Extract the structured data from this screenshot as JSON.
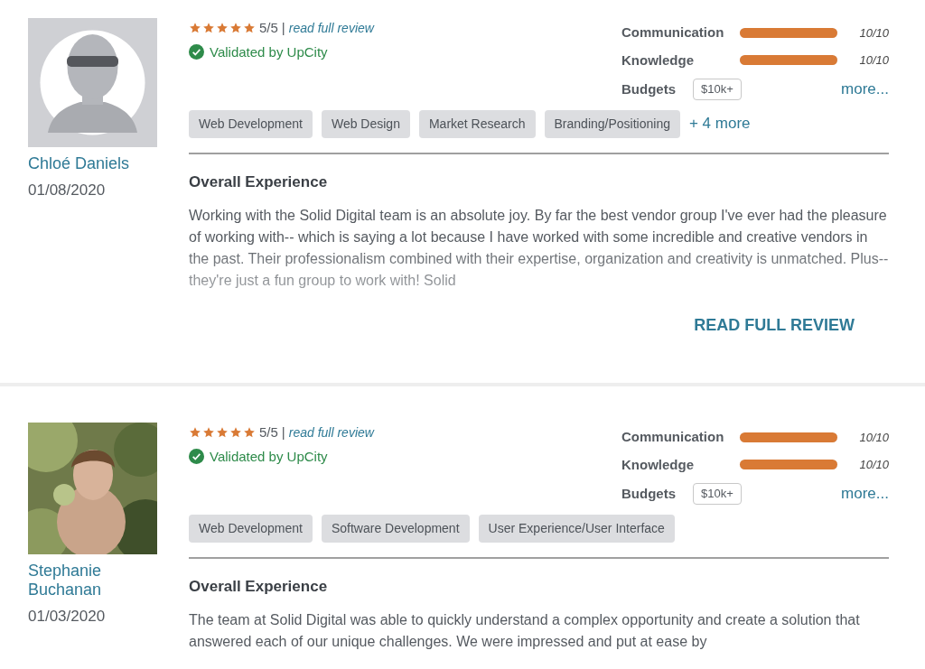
{
  "reviews": [
    {
      "avatar": {
        "kind": "silhouette"
      },
      "name": "Chloé Daniels",
      "date": "01/08/2020",
      "stars": 5,
      "score": "5/5",
      "separator": "|",
      "read_link": "read full review",
      "validated": "Validated by UpCity",
      "ratings": [
        {
          "label": "Communication",
          "level": 1,
          "reading": "10/10"
        },
        {
          "label": "Knowledge",
          "level": 1,
          "reading": "10/10"
        }
      ],
      "budgets_label": "Budgets",
      "budget": "$10k+",
      "more": "more...",
      "tags": [
        "Web Development",
        "Web Design",
        "Market Research",
        "Branding/Positioning"
      ],
      "more_tags": "+ 4 more",
      "section_title": "Overall Experience",
      "text": "Working with the Solid Digital team is an absolute joy. By far the best vendor group I've ever had the pleasure of working with-- which is saying a lot because I have worked with some incredible and creative vendors in the past. Their professionalism combined with their expertise, organization and creativity is unmatched. Plus-- they're just a fun group to work with! Solid",
      "faded": true,
      "read_full": "READ FULL REVIEW"
    },
    {
      "avatar": {
        "kind": "picture"
      },
      "name": "Stephanie Buchanan",
      "date": "01/03/2020",
      "stars": 5,
      "score": "5/5",
      "separator": "|",
      "read_link": "read full review",
      "validated": "Validated by UpCity",
      "ratings": [
        {
          "label": "Communication",
          "level": 1,
          "reading": "10/10"
        },
        {
          "label": "Knowledge",
          "level": 1,
          "reading": "10/10"
        }
      ],
      "budgets_label": "Budgets",
      "budget": "$10k+",
      "more": "more...",
      "tags": [
        "Web Development",
        "Software Development",
        "User Experience/User Interface"
      ],
      "section_title": "Overall Experience",
      "text": "The team at Solid Digital was able to quickly understand a complex opportunity and create a solution that answered each of our unique challenges. We were impressed and put at ease by",
      "faded": false
    }
  ]
}
